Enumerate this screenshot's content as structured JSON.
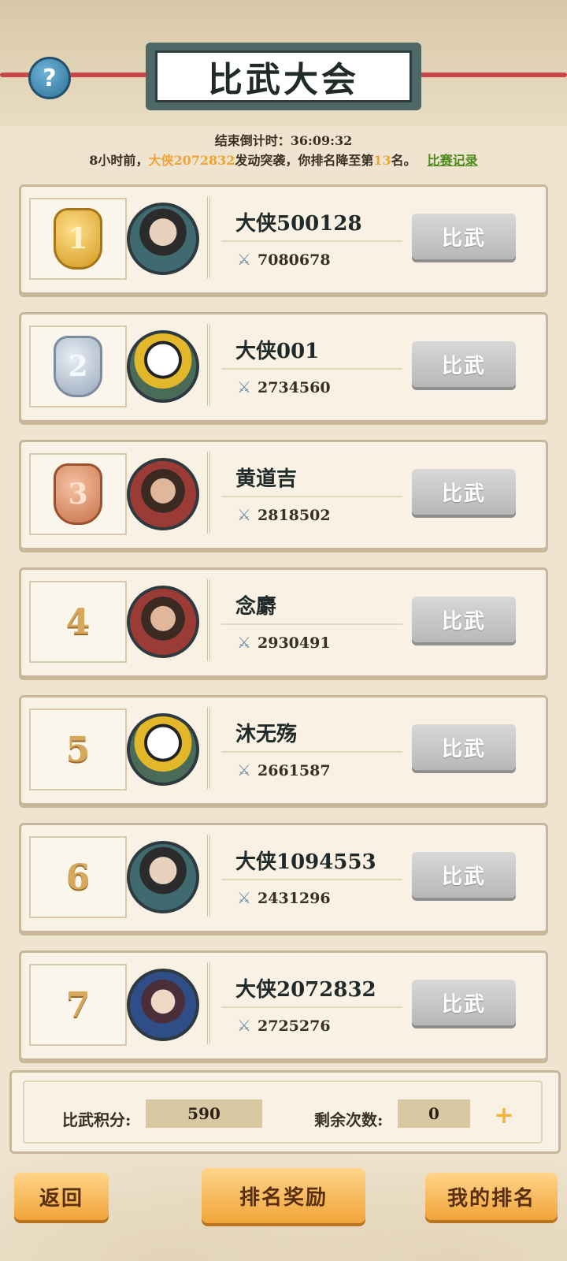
{
  "header": {
    "title": "比武大会",
    "help_symbol": "?"
  },
  "countdown": {
    "label": "结束倒计时：",
    "value": "36:09:32"
  },
  "notice": {
    "time": "8小时前，",
    "attacker": "大侠2072832",
    "middle": "发动突袭，你排名降至第",
    "rank": "13",
    "suffix": "名。",
    "link": "比赛记录"
  },
  "players": [
    {
      "rank": "1",
      "name": "大侠500128",
      "power": "7080678",
      "button": "比武",
      "avatar": "swordsman",
      "medal": "gold"
    },
    {
      "rank": "2",
      "name": "大侠001",
      "power": "2734560",
      "button": "比武",
      "avatar": "panda",
      "medal": "silver"
    },
    {
      "rank": "3",
      "name": "黄道吉",
      "power": "2818502",
      "button": "比武",
      "avatar": "warrior",
      "medal": "bronze"
    },
    {
      "rank": "4",
      "name": "念麝",
      "power": "2930491",
      "button": "比武",
      "avatar": "warrior",
      "medal": ""
    },
    {
      "rank": "5",
      "name": "沐无殇",
      "power": "2661587",
      "button": "比武",
      "avatar": "panda",
      "medal": ""
    },
    {
      "rank": "6",
      "name": "大侠1094553",
      "power": "2431296",
      "button": "比武",
      "avatar": "swordsman",
      "medal": ""
    },
    {
      "rank": "7",
      "name": "大侠2072832",
      "power": "2725276",
      "button": "比武",
      "avatar": "lady",
      "medal": ""
    }
  ],
  "stats": {
    "score_label": "比武积分:",
    "score_value": "590",
    "remaining_label": "剩余次数:",
    "remaining_value": "0",
    "plus_symbol": "+"
  },
  "footer": {
    "back": "返回",
    "rewards": "排名奖励",
    "my_rank": "我的排名"
  },
  "icons": {
    "power": "crossed-swords-icon"
  }
}
